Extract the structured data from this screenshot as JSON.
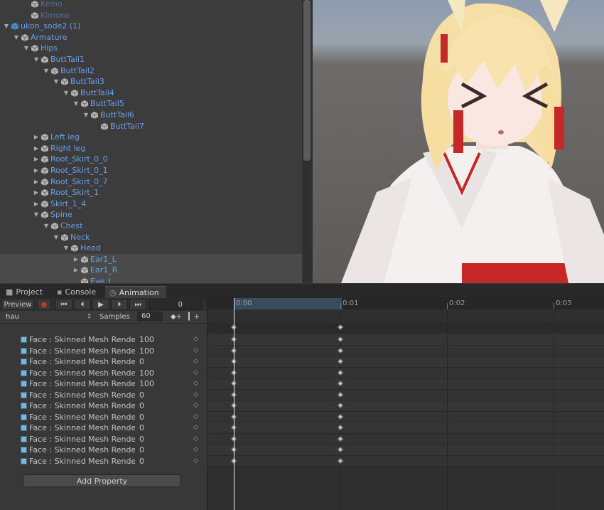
{
  "hierarchy": {
    "items": [
      {
        "label": "Kemo",
        "depth": 3,
        "arrow": "",
        "dim": true
      },
      {
        "label": "Kimono",
        "depth": 3,
        "arrow": "",
        "dim": true
      },
      {
        "label": "ukon_sode2 (1)",
        "depth": 1,
        "arrow": "down",
        "prefab": true
      },
      {
        "label": "Armature",
        "depth": 2,
        "arrow": "down"
      },
      {
        "label": "Hips",
        "depth": 3,
        "arrow": "down"
      },
      {
        "label": "ButtTail1",
        "depth": 4,
        "arrow": "down"
      },
      {
        "label": "ButtTail2",
        "depth": 5,
        "arrow": "down"
      },
      {
        "label": "ButtTail3",
        "depth": 6,
        "arrow": "down"
      },
      {
        "label": "ButtTail4",
        "depth": 7,
        "arrow": "down"
      },
      {
        "label": "ButtTail5",
        "depth": 8,
        "arrow": "down"
      },
      {
        "label": "ButtTail6",
        "depth": 9,
        "arrow": "down"
      },
      {
        "label": "ButtTail7",
        "depth": 10,
        "arrow": ""
      },
      {
        "label": "Left leg",
        "depth": 4,
        "arrow": "right"
      },
      {
        "label": "Right leg",
        "depth": 4,
        "arrow": "right"
      },
      {
        "label": "Root_Skirt_0_0",
        "depth": 4,
        "arrow": "right"
      },
      {
        "label": "Root_Skirt_0_1",
        "depth": 4,
        "arrow": "right"
      },
      {
        "label": "Root_Skirt_0_7",
        "depth": 4,
        "arrow": "right"
      },
      {
        "label": "Root_Skirt_1",
        "depth": 4,
        "arrow": "right"
      },
      {
        "label": "Skirt_1_4",
        "depth": 4,
        "arrow": "right"
      },
      {
        "label": "Spine",
        "depth": 4,
        "arrow": "down"
      },
      {
        "label": "Chest",
        "depth": 5,
        "arrow": "down"
      },
      {
        "label": "Neck",
        "depth": 6,
        "arrow": "down"
      },
      {
        "label": "Head",
        "depth": 7,
        "arrow": "down"
      },
      {
        "label": "Ear1_L",
        "depth": 8,
        "arrow": "right",
        "selected": true
      },
      {
        "label": "Ear1_R",
        "depth": 8,
        "arrow": "right",
        "selected": true
      },
      {
        "label": "Eye_L",
        "depth": 8,
        "arrow": "",
        "selected": true
      }
    ]
  },
  "tabs": [
    {
      "label": "Project",
      "icon": "folder-icon",
      "active": false
    },
    {
      "label": "Console",
      "icon": "console-icon",
      "active": false
    },
    {
      "label": "Animation",
      "icon": "clock-icon",
      "active": true
    }
  ],
  "animation": {
    "preview_label": "Preview",
    "frame_value": "0",
    "clip_name": "hau",
    "samples_label": "Samples",
    "samples_value": "60",
    "add_property_label": "Add Property",
    "properties": [
      {
        "name": "Face : Skinned Mesh Renderer",
        "value": "100"
      },
      {
        "name": "Face : Skinned Mesh Renderer",
        "value": "100"
      },
      {
        "name": "Face : Skinned Mesh Renderer",
        "value": "0"
      },
      {
        "name": "Face : Skinned Mesh Renderer",
        "value": "100"
      },
      {
        "name": "Face : Skinned Mesh Renderer",
        "value": "100"
      },
      {
        "name": "Face : Skinned Mesh Renderer",
        "value": "0"
      },
      {
        "name": "Face : Skinned Mesh Renderer",
        "value": "0"
      },
      {
        "name": "Face : Skinned Mesh Renderer",
        "value": "0"
      },
      {
        "name": "Face : Skinned Mesh Renderer",
        "value": "0"
      },
      {
        "name": "Face : Skinned Mesh Renderer",
        "value": "0"
      },
      {
        "name": "Face : Skinned Mesh Renderer",
        "value": "0"
      },
      {
        "name": "Face : Skinned Mesh Renderer",
        "value": "0"
      }
    ],
    "ruler_ticks": [
      "0:00",
      "0:01",
      "0:02",
      "0:03"
    ],
    "keyframe_times": [
      "0:00",
      "0:01"
    ]
  },
  "colors": {
    "hierarchy_text": "#6a9fe8",
    "playhead": "#e8e8e8",
    "record": "#c0392b"
  }
}
